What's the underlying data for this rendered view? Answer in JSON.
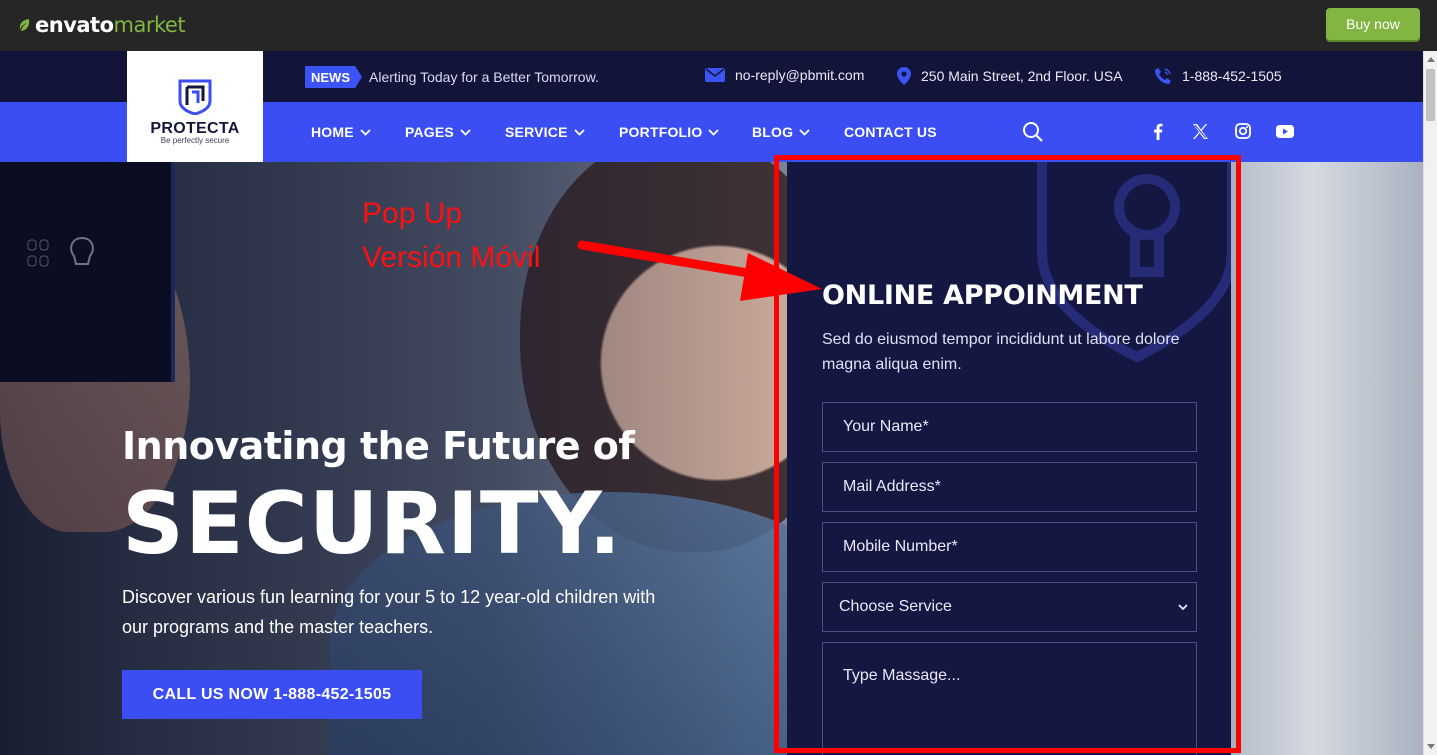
{
  "envato": {
    "logo_word1": "envato",
    "logo_word2": "market",
    "buy_label": "Buy now",
    "brand_color": "#82b541"
  },
  "topbar": {
    "news_badge": "NEWS",
    "news_text": "Alerting Today for a Better Tomorrow.",
    "email": "no-reply@pbmit.com",
    "address": "250 Main Street, 2nd Floor. USA",
    "phone": "1-888-452-1505"
  },
  "logo": {
    "title": "PROTECTA",
    "subtitle": "Be perfectly secure"
  },
  "nav": {
    "items": [
      {
        "label": "HOME"
      },
      {
        "label": "PAGES"
      },
      {
        "label": "SERVICE"
      },
      {
        "label": "PORTFOLIO"
      },
      {
        "label": "BLOG"
      },
      {
        "label": "CONTACT US"
      }
    ],
    "icons": [
      "search-icon",
      "facebook-icon",
      "x-icon",
      "instagram-icon",
      "youtube-icon"
    ],
    "accent": "#3a4ef3"
  },
  "hero": {
    "line1": "Innovating the Future of",
    "line2": "SECURITY.",
    "description": "Discover various fun learning for your 5 to 12 year-old children with our programs and the master teachers.",
    "cta": "CALL US NOW 1-888-452-1505"
  },
  "annotation": {
    "line1": "Pop Up",
    "line2": "Versión Móvil",
    "color": "#ff0000"
  },
  "form": {
    "title": "ONLINE APPOINMENT",
    "description": "Sed do eiusmod tempor incididunt ut labore dolore magna aliqua enim.",
    "name_placeholder": "Your Name*",
    "mail_placeholder": "Mail Address*",
    "mobile_placeholder": "Mobile Number*",
    "service_selected": "Choose Service",
    "message_placeholder": "Type Massage..."
  }
}
